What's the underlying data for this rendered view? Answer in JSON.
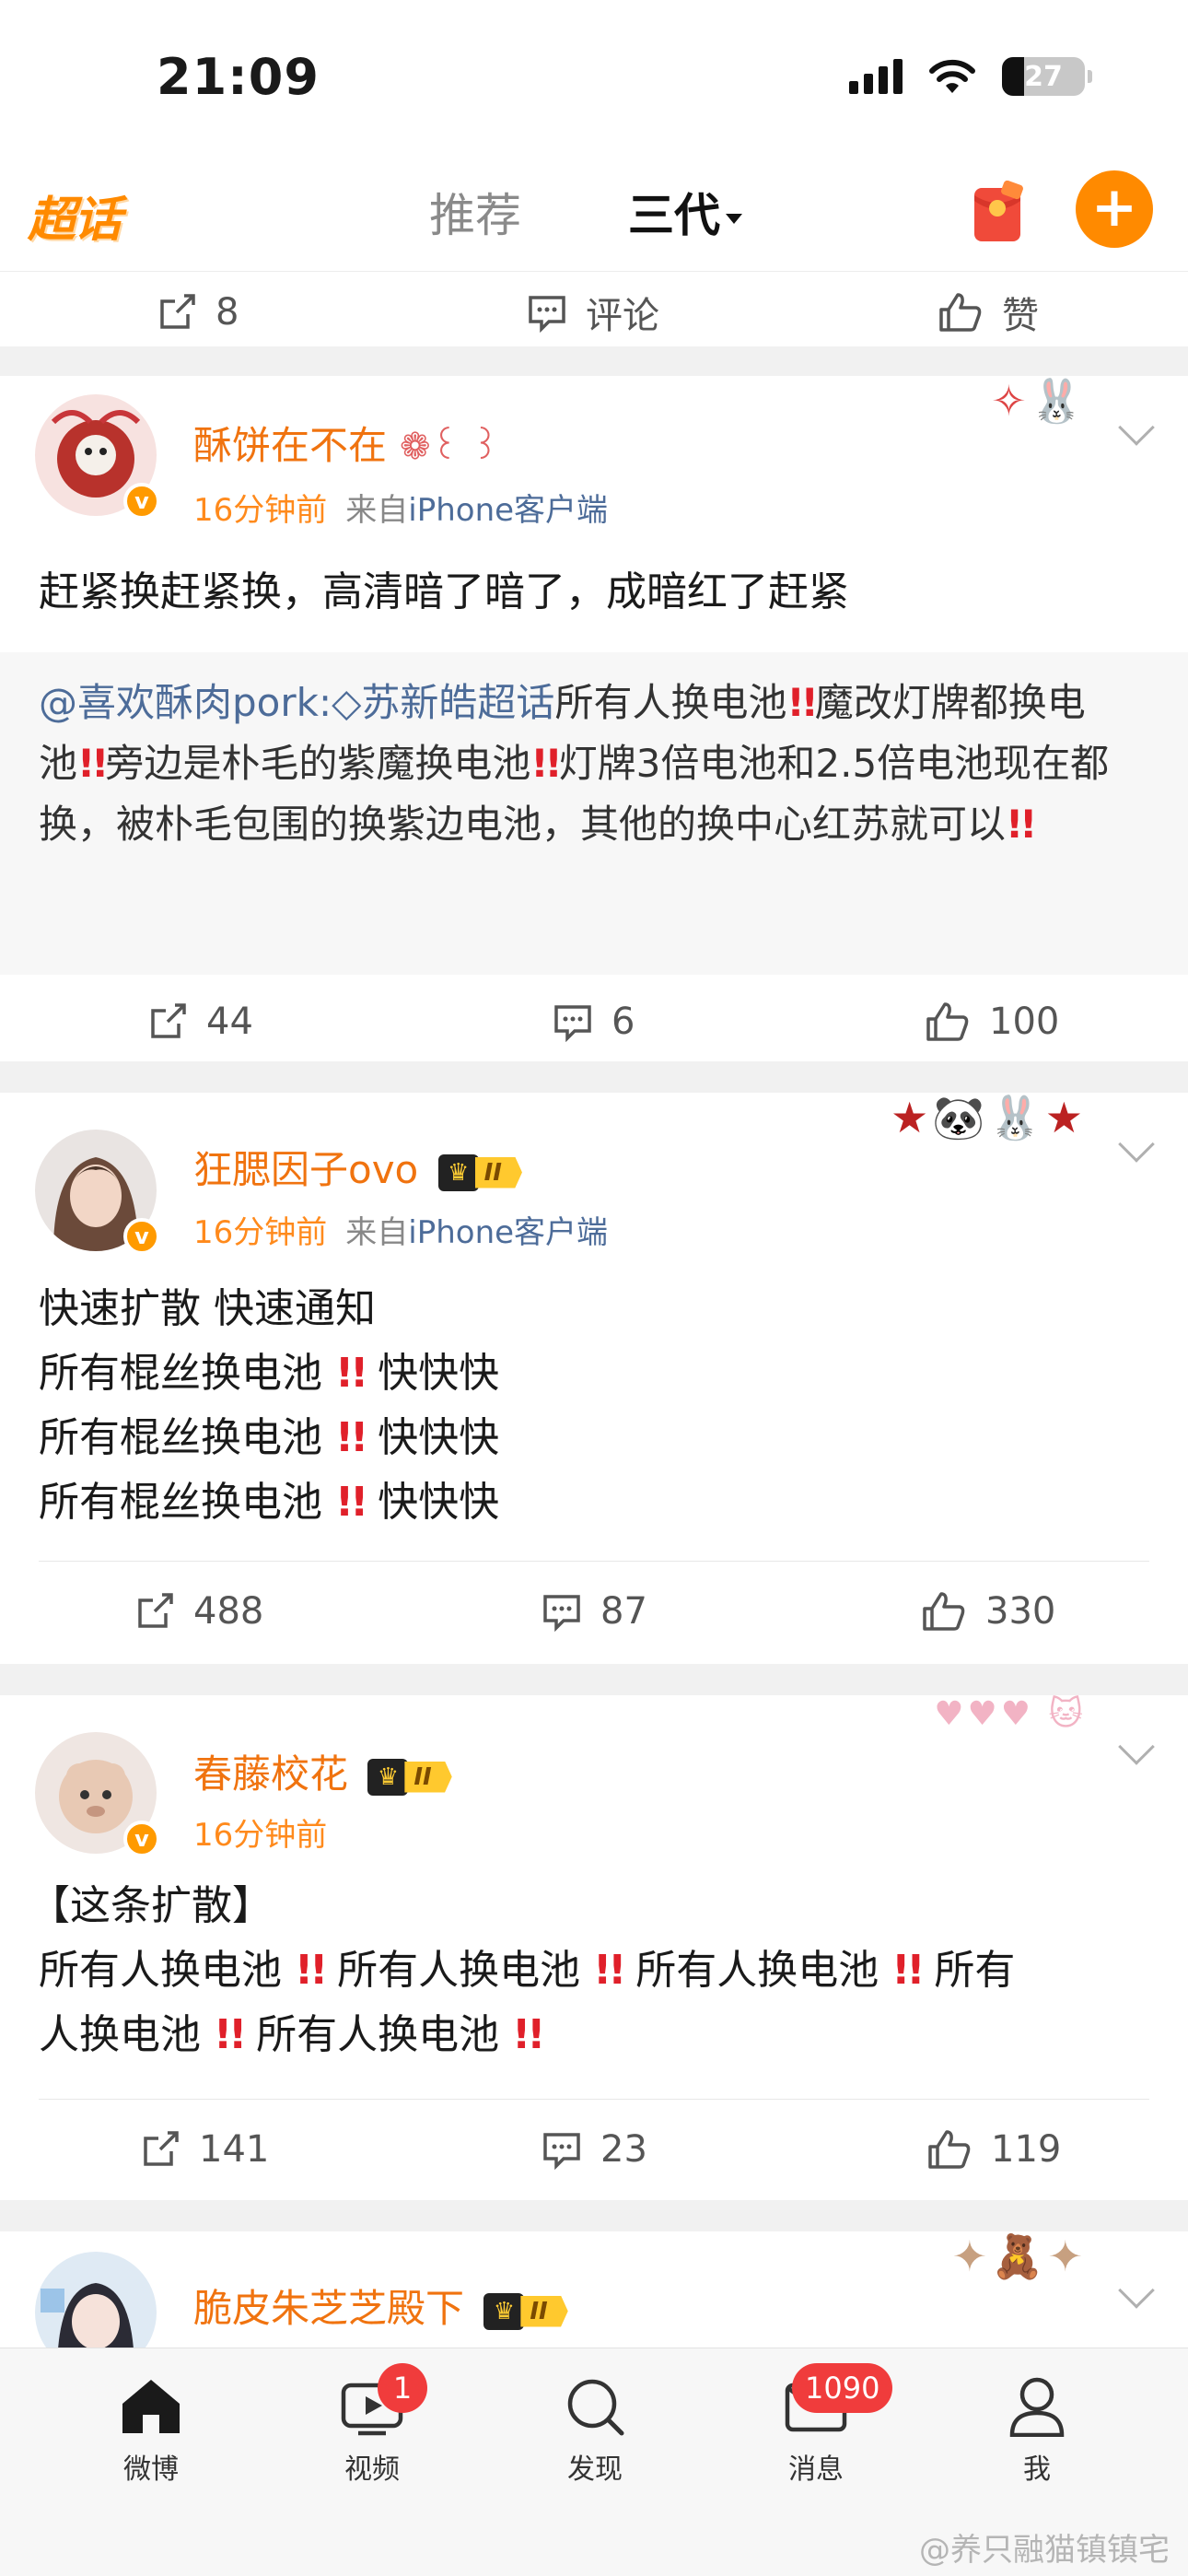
{
  "status": {
    "time": "21:09",
    "battery": "27"
  },
  "nav": {
    "logo": "超话",
    "tabs": [
      {
        "label": "推荐"
      },
      {
        "label": "三代"
      }
    ]
  },
  "prev_post_actions": {
    "repost": "8",
    "comment": "评论",
    "like": "赞"
  },
  "posts": [
    {
      "user": "酥饼在不在",
      "time": "16分钟前",
      "source_prefix": "来自",
      "source": "iPhone客户端",
      "body_lines": [
        "赶紧换赶紧换，高清暗了暗了，成暗红了赶紧"
      ],
      "quote": {
        "mention": "@喜欢酥肉pork:",
        "topic": "苏新皓超话",
        "lines": [
          "所有人换电池",
          "魔改灯牌都换电池",
          "旁边是朴毛的紫魔换电池",
          "灯牌3倍电池和2.5倍电池现在都换，被朴毛包围的换紫边电池，其他的换中心红苏就可以"
        ]
      },
      "repost": "44",
      "comment": "6",
      "like": "100"
    },
    {
      "user": "狂腮因子ovo",
      "vip_level": "II",
      "time": "16分钟前",
      "source_prefix": "来自",
      "source": "iPhone客户端",
      "body_lines": [
        "快速扩散 快速通知",
        "所有棍丝换电池",
        "快快快",
        "所有棍丝换电池",
        "快快快",
        "所有棍丝换电池",
        "快快快"
      ],
      "repost": "488",
      "comment": "87",
      "like": "330"
    },
    {
      "user": "春藤校花",
      "vip_level": "II",
      "time": "16分钟前",
      "body_lines": [
        "【这条扩散】",
        "所有人换电池",
        "所有人换电池",
        "所有人换电池",
        "所有",
        "人换电池",
        "所有人换电池"
      ],
      "repost": "141",
      "comment": "23",
      "like": "119"
    },
    {
      "user": "脆皮朱芝芝殿下",
      "vip_level": "II"
    }
  ],
  "bottom_tabs": [
    {
      "label": "微博",
      "icon": "home-icon"
    },
    {
      "label": "视频",
      "icon": "video-icon",
      "badge": "1"
    },
    {
      "label": "发现",
      "icon": "search-icon"
    },
    {
      "label": "消息",
      "icon": "message-icon",
      "badge": "1090"
    },
    {
      "label": "我",
      "icon": "profile-icon"
    }
  ],
  "watermark": "@养只融猫镇镇宅",
  "colors": {
    "accent": "#ff8a00",
    "username": "#f0730f",
    "link": "#4d6c99",
    "alert": "#e0202a"
  }
}
